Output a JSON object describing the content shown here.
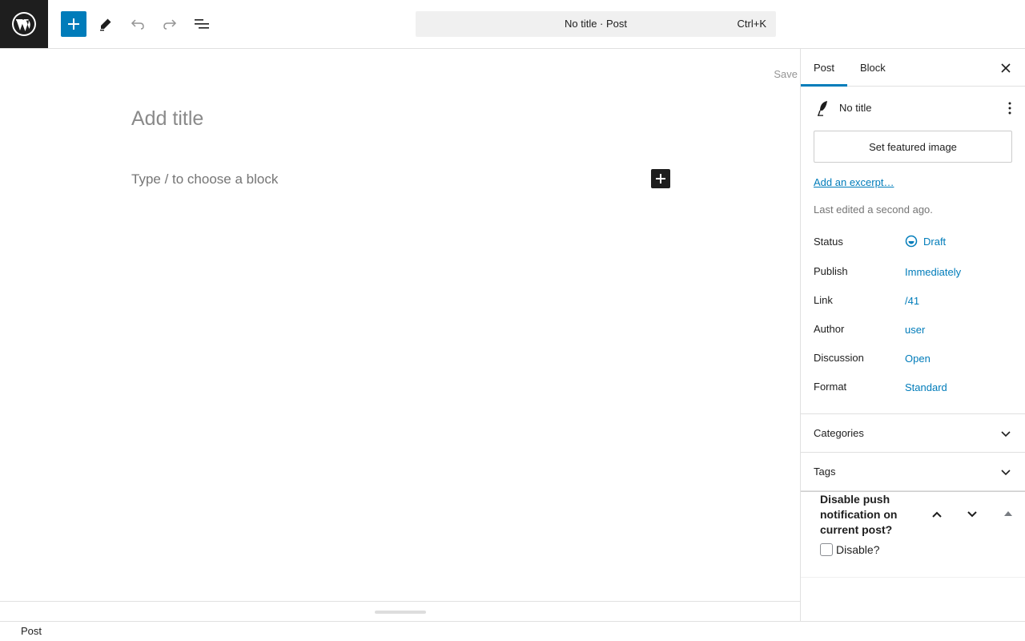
{
  "topbar": {
    "logo_icon": "wordpress-logo-icon",
    "inserter_icon": "plus-icon",
    "tools_icon": "pencil-icon",
    "undo_icon": "undo-icon",
    "redo_icon": "redo-icon",
    "list_view_icon": "list-view-icon",
    "command_title": "No title · Post",
    "command_shortcut": "Ctrl+K"
  },
  "canvas": {
    "save_label": "Save",
    "title_placeholder": "Add title",
    "block_placeholder": "Type / to choose a block",
    "block_add_icon": "plus-icon"
  },
  "sidebar": {
    "tabs": [
      {
        "label": "Post",
        "active": true
      },
      {
        "label": "Block",
        "active": false
      }
    ],
    "close_icon": "close-icon",
    "post_title": "No title",
    "featured_image_label": "Set featured image",
    "excerpt_link": "Add an excerpt…",
    "last_edited": "Last edited a second ago.",
    "meta": [
      {
        "label": "Status",
        "value": "Draft"
      },
      {
        "label": "Publish",
        "value": "Immediately"
      },
      {
        "label": "Link",
        "value": "/41"
      },
      {
        "label": "Author",
        "value": "user"
      },
      {
        "label": "Discussion",
        "value": "Open"
      },
      {
        "label": "Format",
        "value": "Standard"
      }
    ],
    "panels": [
      {
        "label": "Categories"
      },
      {
        "label": "Tags"
      }
    ],
    "push": {
      "title": "Disable push notification on current post?",
      "checkbox_label": "Disable?",
      "checked": false
    }
  },
  "footer": {
    "breadcrumb": "Post"
  },
  "colors": {
    "accent": "#007cba",
    "dark": "#1e1e1e",
    "border": "#e0e0e0"
  }
}
